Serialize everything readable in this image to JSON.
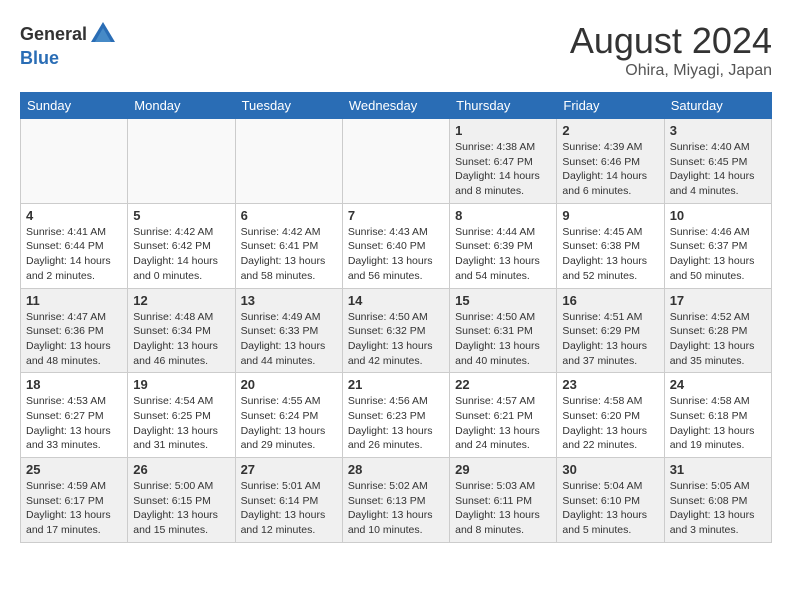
{
  "header": {
    "logo_general": "General",
    "logo_blue": "Blue",
    "month": "August 2024",
    "location": "Ohira, Miyagi, Japan"
  },
  "days_of_week": [
    "Sunday",
    "Monday",
    "Tuesday",
    "Wednesday",
    "Thursday",
    "Friday",
    "Saturday"
  ],
  "weeks": [
    [
      {
        "num": "",
        "info": "",
        "empty": true
      },
      {
        "num": "",
        "info": "",
        "empty": true
      },
      {
        "num": "",
        "info": "",
        "empty": true
      },
      {
        "num": "",
        "info": "",
        "empty": true
      },
      {
        "num": "1",
        "info": "Sunrise: 4:38 AM\nSunset: 6:47 PM\nDaylight: 14 hours\nand 8 minutes.",
        "empty": false
      },
      {
        "num": "2",
        "info": "Sunrise: 4:39 AM\nSunset: 6:46 PM\nDaylight: 14 hours\nand 6 minutes.",
        "empty": false
      },
      {
        "num": "3",
        "info": "Sunrise: 4:40 AM\nSunset: 6:45 PM\nDaylight: 14 hours\nand 4 minutes.",
        "empty": false
      }
    ],
    [
      {
        "num": "4",
        "info": "Sunrise: 4:41 AM\nSunset: 6:44 PM\nDaylight: 14 hours\nand 2 minutes.",
        "empty": false
      },
      {
        "num": "5",
        "info": "Sunrise: 4:42 AM\nSunset: 6:42 PM\nDaylight: 14 hours\nand 0 minutes.",
        "empty": false
      },
      {
        "num": "6",
        "info": "Sunrise: 4:42 AM\nSunset: 6:41 PM\nDaylight: 13 hours\nand 58 minutes.",
        "empty": false
      },
      {
        "num": "7",
        "info": "Sunrise: 4:43 AM\nSunset: 6:40 PM\nDaylight: 13 hours\nand 56 minutes.",
        "empty": false
      },
      {
        "num": "8",
        "info": "Sunrise: 4:44 AM\nSunset: 6:39 PM\nDaylight: 13 hours\nand 54 minutes.",
        "empty": false
      },
      {
        "num": "9",
        "info": "Sunrise: 4:45 AM\nSunset: 6:38 PM\nDaylight: 13 hours\nand 52 minutes.",
        "empty": false
      },
      {
        "num": "10",
        "info": "Sunrise: 4:46 AM\nSunset: 6:37 PM\nDaylight: 13 hours\nand 50 minutes.",
        "empty": false
      }
    ],
    [
      {
        "num": "11",
        "info": "Sunrise: 4:47 AM\nSunset: 6:36 PM\nDaylight: 13 hours\nand 48 minutes.",
        "empty": false
      },
      {
        "num": "12",
        "info": "Sunrise: 4:48 AM\nSunset: 6:34 PM\nDaylight: 13 hours\nand 46 minutes.",
        "empty": false
      },
      {
        "num": "13",
        "info": "Sunrise: 4:49 AM\nSunset: 6:33 PM\nDaylight: 13 hours\nand 44 minutes.",
        "empty": false
      },
      {
        "num": "14",
        "info": "Sunrise: 4:50 AM\nSunset: 6:32 PM\nDaylight: 13 hours\nand 42 minutes.",
        "empty": false
      },
      {
        "num": "15",
        "info": "Sunrise: 4:50 AM\nSunset: 6:31 PM\nDaylight: 13 hours\nand 40 minutes.",
        "empty": false
      },
      {
        "num": "16",
        "info": "Sunrise: 4:51 AM\nSunset: 6:29 PM\nDaylight: 13 hours\nand 37 minutes.",
        "empty": false
      },
      {
        "num": "17",
        "info": "Sunrise: 4:52 AM\nSunset: 6:28 PM\nDaylight: 13 hours\nand 35 minutes.",
        "empty": false
      }
    ],
    [
      {
        "num": "18",
        "info": "Sunrise: 4:53 AM\nSunset: 6:27 PM\nDaylight: 13 hours\nand 33 minutes.",
        "empty": false
      },
      {
        "num": "19",
        "info": "Sunrise: 4:54 AM\nSunset: 6:25 PM\nDaylight: 13 hours\nand 31 minutes.",
        "empty": false
      },
      {
        "num": "20",
        "info": "Sunrise: 4:55 AM\nSunset: 6:24 PM\nDaylight: 13 hours\nand 29 minutes.",
        "empty": false
      },
      {
        "num": "21",
        "info": "Sunrise: 4:56 AM\nSunset: 6:23 PM\nDaylight: 13 hours\nand 26 minutes.",
        "empty": false
      },
      {
        "num": "22",
        "info": "Sunrise: 4:57 AM\nSunset: 6:21 PM\nDaylight: 13 hours\nand 24 minutes.",
        "empty": false
      },
      {
        "num": "23",
        "info": "Sunrise: 4:58 AM\nSunset: 6:20 PM\nDaylight: 13 hours\nand 22 minutes.",
        "empty": false
      },
      {
        "num": "24",
        "info": "Sunrise: 4:58 AM\nSunset: 6:18 PM\nDaylight: 13 hours\nand 19 minutes.",
        "empty": false
      }
    ],
    [
      {
        "num": "25",
        "info": "Sunrise: 4:59 AM\nSunset: 6:17 PM\nDaylight: 13 hours\nand 17 minutes.",
        "empty": false
      },
      {
        "num": "26",
        "info": "Sunrise: 5:00 AM\nSunset: 6:15 PM\nDaylight: 13 hours\nand 15 minutes.",
        "empty": false
      },
      {
        "num": "27",
        "info": "Sunrise: 5:01 AM\nSunset: 6:14 PM\nDaylight: 13 hours\nand 12 minutes.",
        "empty": false
      },
      {
        "num": "28",
        "info": "Sunrise: 5:02 AM\nSunset: 6:13 PM\nDaylight: 13 hours\nand 10 minutes.",
        "empty": false
      },
      {
        "num": "29",
        "info": "Sunrise: 5:03 AM\nSunset: 6:11 PM\nDaylight: 13 hours\nand 8 minutes.",
        "empty": false
      },
      {
        "num": "30",
        "info": "Sunrise: 5:04 AM\nSunset: 6:10 PM\nDaylight: 13 hours\nand 5 minutes.",
        "empty": false
      },
      {
        "num": "31",
        "info": "Sunrise: 5:05 AM\nSunset: 6:08 PM\nDaylight: 13 hours\nand 3 minutes.",
        "empty": false
      }
    ]
  ]
}
